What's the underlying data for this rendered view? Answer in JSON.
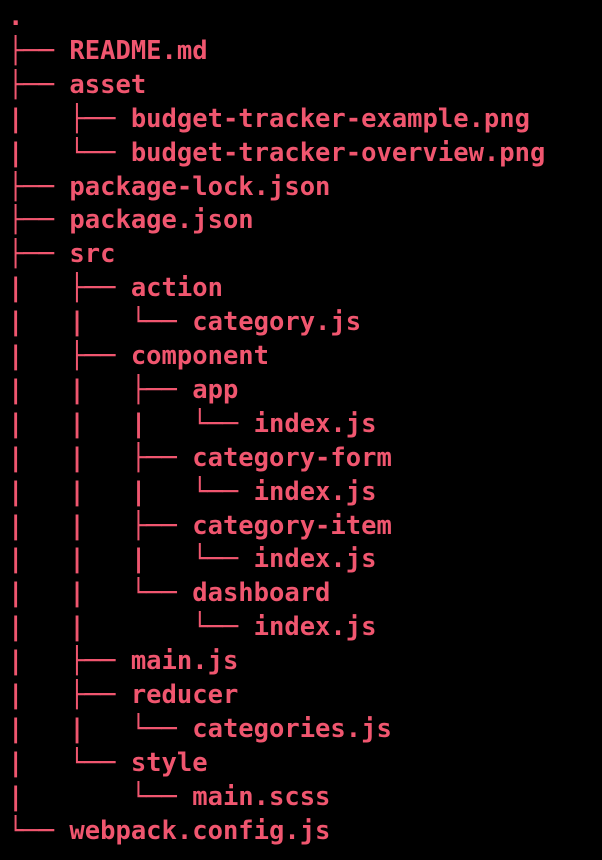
{
  "terminal": {
    "text_color": "#f0566f",
    "background_color": "#000000",
    "lines": [
      {
        "prefix": ".",
        "name": ""
      },
      {
        "prefix": "├── ",
        "name": "README.md"
      },
      {
        "prefix": "├── ",
        "name": "asset"
      },
      {
        "prefix": "|   ├── ",
        "name": "budget-tracker-example.png"
      },
      {
        "prefix": "|   └── ",
        "name": "budget-tracker-overview.png"
      },
      {
        "prefix": "├── ",
        "name": "package-lock.json"
      },
      {
        "prefix": "├── ",
        "name": "package.json"
      },
      {
        "prefix": "├── ",
        "name": "src"
      },
      {
        "prefix": "|   ├── ",
        "name": "action"
      },
      {
        "prefix": "|   |   └── ",
        "name": "category.js"
      },
      {
        "prefix": "|   ├── ",
        "name": "component"
      },
      {
        "prefix": "|   |   ├── ",
        "name": "app"
      },
      {
        "prefix": "|   |   |   └── ",
        "name": "index.js"
      },
      {
        "prefix": "|   |   ├── ",
        "name": "category-form"
      },
      {
        "prefix": "|   |   |   └── ",
        "name": "index.js"
      },
      {
        "prefix": "|   |   ├── ",
        "name": "category-item"
      },
      {
        "prefix": "|   |   |   └── ",
        "name": "index.js"
      },
      {
        "prefix": "|   |   └── ",
        "name": "dashboard"
      },
      {
        "prefix": "|   |       └── ",
        "name": "index.js"
      },
      {
        "prefix": "|   ├── ",
        "name": "main.js"
      },
      {
        "prefix": "|   ├── ",
        "name": "reducer"
      },
      {
        "prefix": "|   |   └── ",
        "name": "categories.js"
      },
      {
        "prefix": "|   └── ",
        "name": "style"
      },
      {
        "prefix": "|       └── ",
        "name": "main.scss"
      },
      {
        "prefix": "└── ",
        "name": "webpack.config.js"
      }
    ]
  }
}
